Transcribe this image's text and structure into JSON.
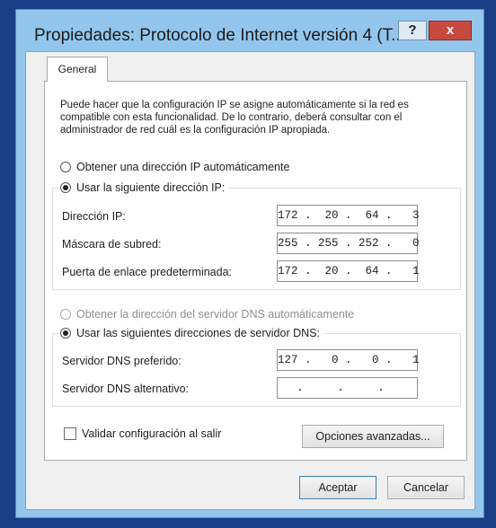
{
  "window": {
    "title": "Propiedades: Protocolo de Internet versión 4 (T...",
    "help_label": "?",
    "close_label": "x"
  },
  "tabs": [
    {
      "label": "General"
    }
  ],
  "description": "Puede hacer que la configuración IP se asigne automáticamente si la red es compatible con esta funcionalidad. De lo contrario, deberá consultar con el administrador de red cuál es la configuración IP apropiada.",
  "ip_section": {
    "auto_option": "Obtener una dirección IP automáticamente",
    "manual_option": "Usar la siguiente dirección IP:",
    "selected": "manual",
    "fields": [
      {
        "label": "Dirección IP:",
        "value": "172 .  20 .  64 .   3"
      },
      {
        "label": "Máscara de subred:",
        "value": "255 . 255 . 252 .   0"
      },
      {
        "label": "Puerta de enlace predeterminada:",
        "value": "172 .  20 .  64 .   1"
      }
    ]
  },
  "dns_section": {
    "auto_option": "Obtener la dirección del servidor DNS automáticamente",
    "manual_option": "Usar las siguientes direcciones de servidor DNS:",
    "selected": "manual",
    "fields": [
      {
        "label": "Servidor DNS preferido:",
        "value": "127 .   0 .   0 .   1"
      },
      {
        "label": "Servidor DNS alternativo:",
        "value": "  .     .     .    "
      }
    ]
  },
  "validate_checkbox": {
    "label": "Validar configuración al salir",
    "checked": false
  },
  "buttons": {
    "advanced": "Opciones avanzadas...",
    "accept": "Aceptar",
    "cancel": "Cancelar"
  }
}
